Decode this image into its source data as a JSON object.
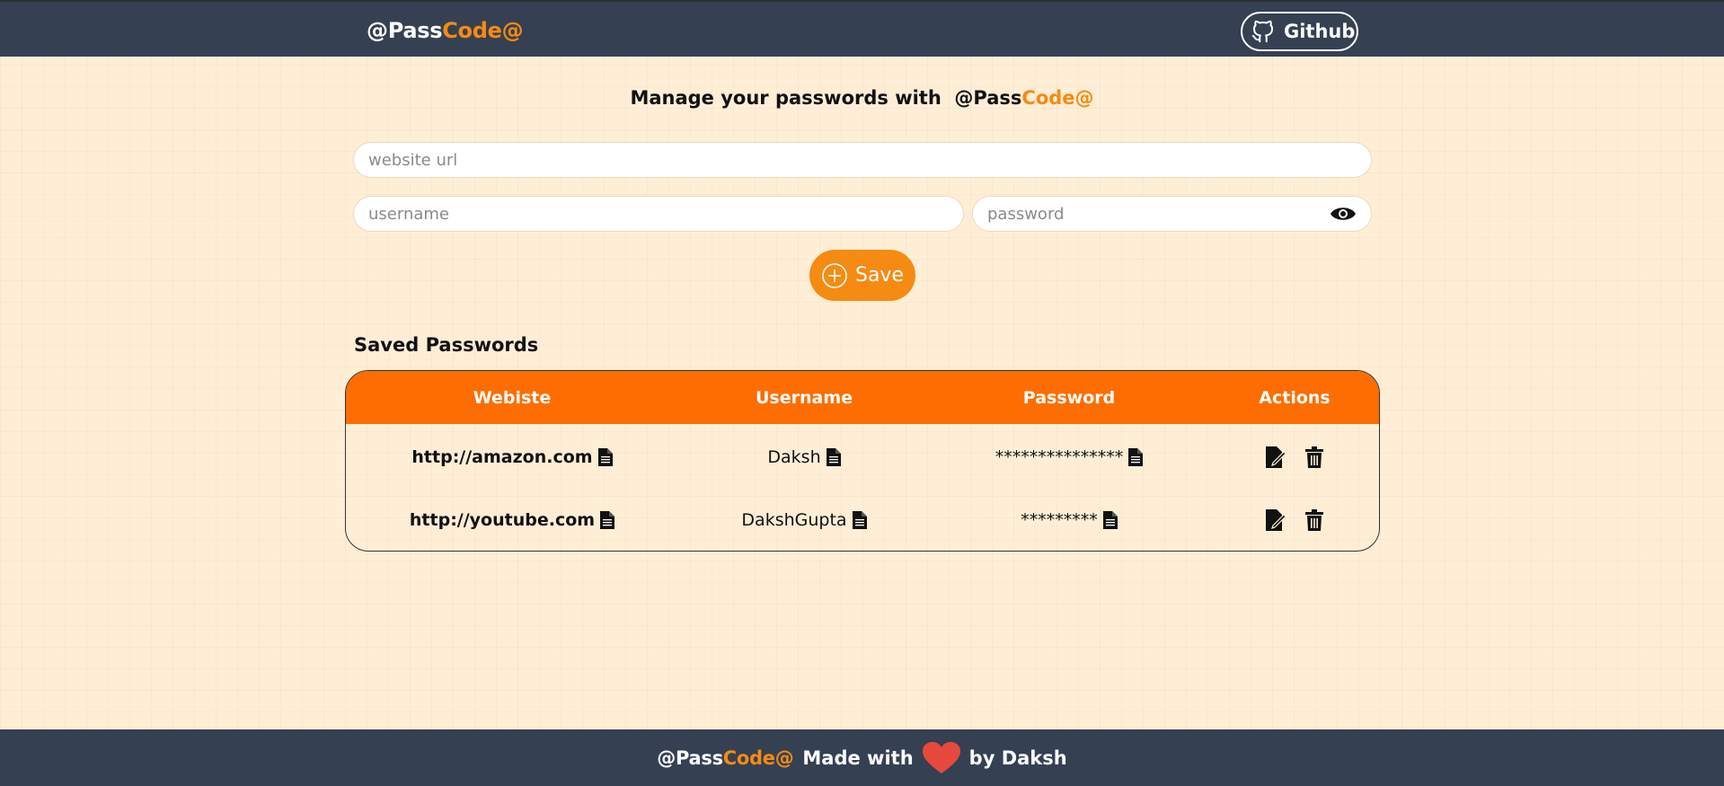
{
  "app": {
    "brand_prefix": "@Pass",
    "brand_suffix": "Code@"
  },
  "nav": {
    "github_label": "Github"
  },
  "main": {
    "heading_text": "Manage your passwords with",
    "url_placeholder": "website url",
    "username_placeholder": "username",
    "password_placeholder": "password",
    "save_label": "Save",
    "saved_title": "Saved Passwords"
  },
  "table": {
    "headers": [
      "Webiste",
      "Username",
      "Password",
      "Actions"
    ],
    "rows": [
      {
        "site": "http://amazon.com",
        "username": "Daksh",
        "password": "***************"
      },
      {
        "site": "http://youtube.com",
        "username": "DakshGupta",
        "password": "*********"
      }
    ]
  },
  "footer": {
    "made_with": "Made with",
    "by": "by Daksh"
  },
  "colors": {
    "nav_bg": "#354052",
    "page_bg": "#feeed6",
    "accent": "#f58b13",
    "table_header": "#fe6d01",
    "heart": "#e64a3c"
  },
  "icons": {
    "github": "github-icon",
    "eye": "eye-icon",
    "save": "plus-circle-icon",
    "copy": "copy-document-icon",
    "edit": "edit-icon",
    "delete": "trash-icon",
    "heart": "heart-icon"
  }
}
